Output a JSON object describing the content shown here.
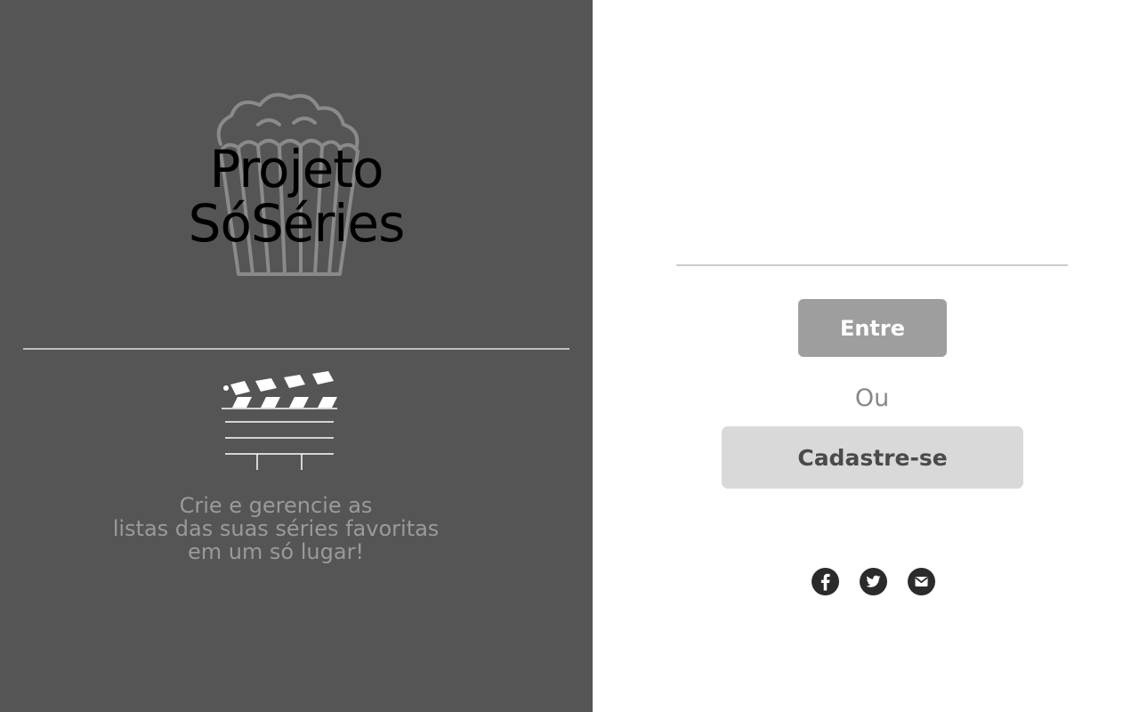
{
  "brand": {
    "title_line1": "Projeto",
    "title_line2": "SóSéries",
    "icon": "popcorn-icon"
  },
  "intro": {
    "icon": "clapperboard-icon",
    "tagline_line1": "Crie e gerencie as",
    "tagline_line2": "listas das suas séries favoritas",
    "tagline_line3": "em um só lugar!"
  },
  "auth": {
    "login_label": "Entre",
    "or_label": "Ou",
    "signup_label": "Cadastre-se"
  },
  "social": [
    {
      "name": "facebook",
      "icon": "facebook-icon"
    },
    {
      "name": "twitter",
      "icon": "twitter-icon"
    },
    {
      "name": "email",
      "icon": "mail-icon"
    }
  ],
  "colors": {
    "left_panel": "#555555",
    "login_button": "#9e9e9e",
    "signup_button": "#d9d9d9",
    "social_icon": "#2b2b2b"
  }
}
